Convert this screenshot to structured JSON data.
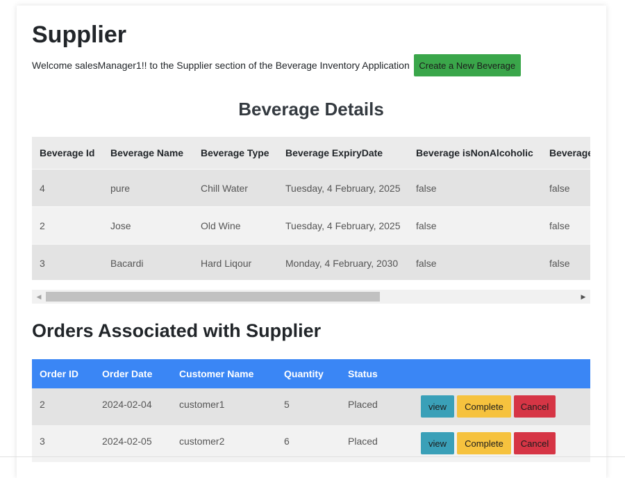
{
  "header": {
    "title": "Supplier",
    "welcome": "Welcome salesManager1!! to the Supplier section of the Beverage Inventory Application",
    "create_button": "Create a New Beverage"
  },
  "beverages": {
    "title": "Beverage Details",
    "columns": [
      "Beverage Id",
      "Beverage Name",
      "Beverage Type",
      "Beverage ExpiryDate",
      "Beverage isNonAlcoholic",
      "Beverage"
    ],
    "rows": [
      [
        "4",
        "pure",
        "Chill Water",
        "Tuesday, 4 February, 2025",
        "false",
        "false"
      ],
      [
        "2",
        "Jose",
        "Old Wine",
        "Tuesday, 4 February, 2025",
        "false",
        "false"
      ],
      [
        "3",
        "Bacardi",
        "Hard Liqour",
        "Monday, 4 February, 2030",
        "false",
        "false"
      ]
    ],
    "scroll_left_glyph": "◀",
    "scroll_right_glyph": "▶"
  },
  "orders": {
    "title": "Orders Associated with Supplier",
    "columns": [
      "Order ID",
      "Order Date",
      "Customer Name",
      "Quantity",
      "Status"
    ],
    "rows": [
      [
        "2",
        "2024-02-04",
        "customer1",
        "5",
        "Placed"
      ],
      [
        "3",
        "2024-02-05",
        "customer2",
        "6",
        "Placed"
      ]
    ],
    "actions": {
      "view": "view",
      "complete": "Complete",
      "cancel": "Cancel"
    }
  },
  "colors": {
    "create_button": "#3aa64a",
    "orders_header": "#3a86f5",
    "view_button": "#3aa0b8",
    "complete_button": "#f6c23e",
    "cancel_button": "#d63545"
  }
}
